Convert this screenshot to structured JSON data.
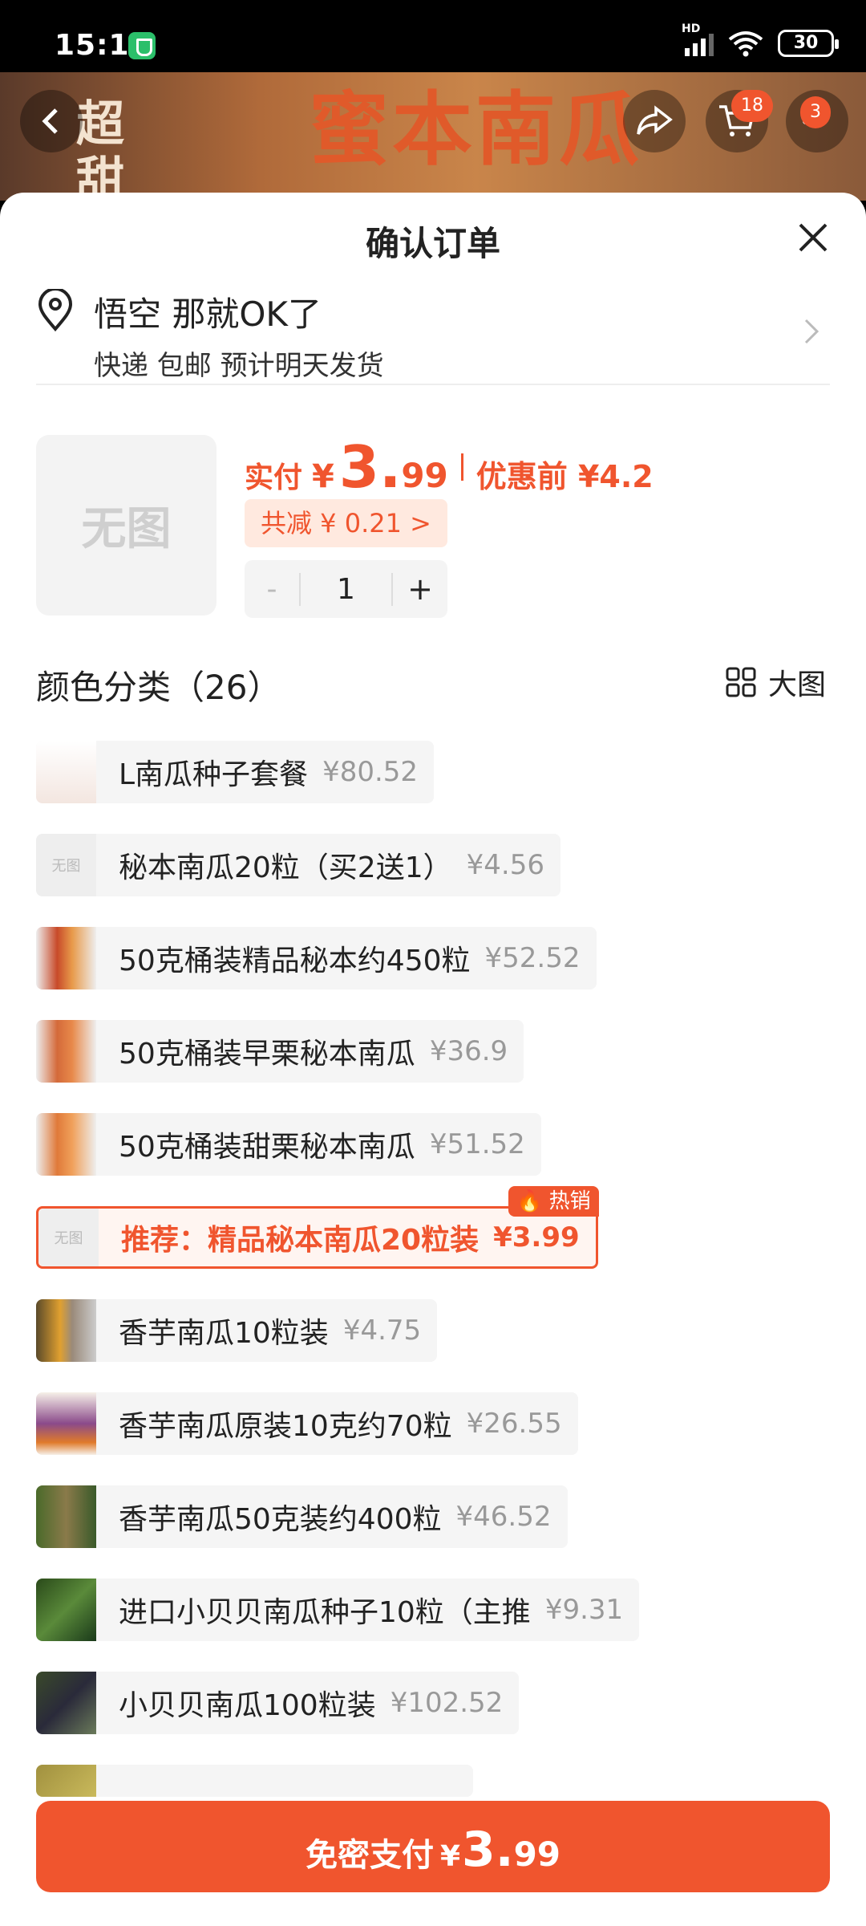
{
  "status_bar": {
    "time": "15:11",
    "battery": "30",
    "network_label": "HD"
  },
  "banner": {
    "title": "蜜本南瓜",
    "side_text": "超甜",
    "cart_badge": "18",
    "more_badge": "3"
  },
  "sheet": {
    "title": "确认订单",
    "address": {
      "name": "悟空 那就OK了",
      "subtitle": "快递 包邮 预计明天发货"
    },
    "product": {
      "thumb_text": "无图",
      "price_label": "实付",
      "price_currency": "¥",
      "price_int": "3.",
      "price_dec": "99",
      "original_price": "优惠前 ¥4.2",
      "discount": "共减 ¥ 0.21 >",
      "quantity": "1",
      "minus": "-",
      "plus": "+"
    },
    "category": {
      "title": "颜色分类（26）",
      "big_view": "大图"
    },
    "options": [
      {
        "name": "L南瓜种子套餐",
        "price": "¥80.52"
      },
      {
        "name": "秘本南瓜20粒（买2送1）",
        "price": "¥4.56",
        "thumb_text": "无图"
      },
      {
        "name": "50克桶装精品秘本约450粒",
        "price": "¥52.52"
      },
      {
        "name": "50克桶装早栗秘本南瓜",
        "price": "¥36.9"
      },
      {
        "name": "50克桶装甜栗秘本南瓜",
        "price": "¥51.52"
      },
      {
        "name": "推荐：精品秘本南瓜20粒装",
        "price": "¥3.99",
        "thumb_text": "无图",
        "tag": "热销",
        "selected": true
      },
      {
        "name": "香芋南瓜10粒装",
        "price": "¥4.75"
      },
      {
        "name": "香芋南瓜原装10克约70粒",
        "price": "¥26.55"
      },
      {
        "name": "香芋南瓜50克装约400粒",
        "price": "¥46.52"
      },
      {
        "name": "进口小贝贝南瓜种子10粒（主推",
        "price": "¥9.31"
      },
      {
        "name": "小贝贝南瓜100粒装",
        "price": "¥102.52"
      }
    ],
    "pay": {
      "label": "免密支付",
      "currency": "¥",
      "int": "3.",
      "dec": "99"
    }
  },
  "colors": {
    "accent": "#f0552e",
    "accent_bg": "#ffe9df",
    "option_bg": "#f5f5f5",
    "muted": "#999999"
  },
  "icons": [
    "shield-icon",
    "hd-signal-icon",
    "wifi-icon",
    "battery-icon",
    "back-icon",
    "share-icon",
    "cart-icon",
    "more-icon",
    "close-icon",
    "location-pin-icon",
    "chevron-right-icon",
    "grid-icon",
    "fire-icon"
  ]
}
